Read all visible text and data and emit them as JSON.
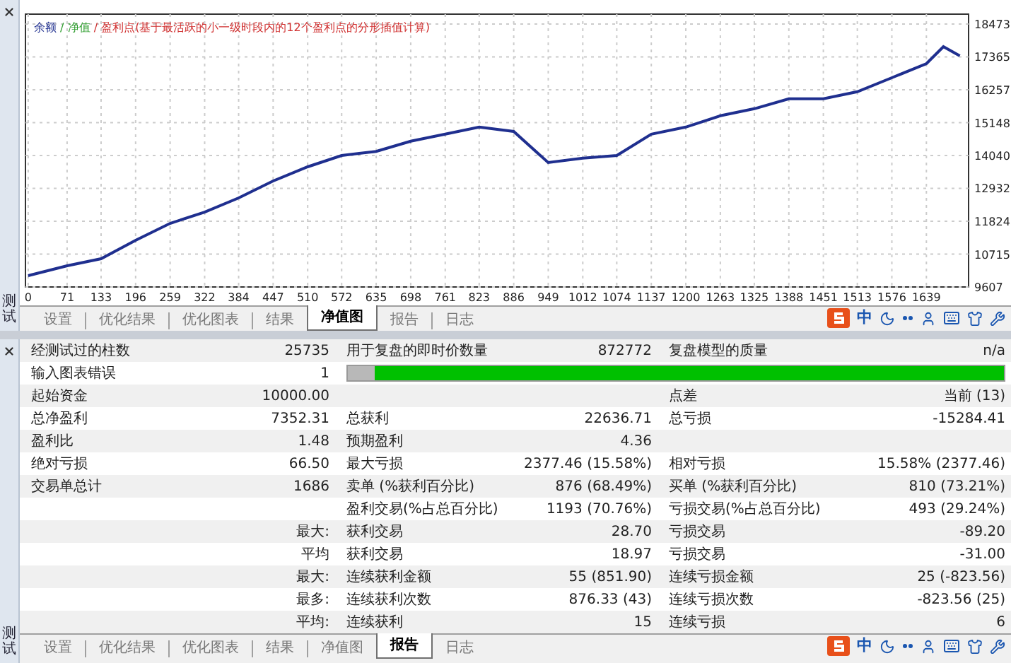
{
  "chart_panel": {
    "side_label": "测试",
    "legend": [
      {
        "text": " / 净值",
        "color": "#2e9e2e"
      },
      {
        "text": " / 盈利点(基于最活跃的小一级时段内的12个盈利点的分形插值计算)",
        "color": "#d03030"
      }
    ],
    "chart_data": {
      "type": "line",
      "grid": true,
      "xlim": [
        -5,
        1716
      ],
      "ylim": [
        9607,
        18473
      ],
      "xticks": [
        0,
        71,
        133,
        196,
        259,
        322,
        384,
        447,
        510,
        572,
        635,
        698,
        761,
        823,
        886,
        949,
        1012,
        1074,
        1137,
        1200,
        1263,
        1325,
        1388,
        1451,
        1513,
        1576,
        1639
      ],
      "yticks": [
        9607,
        10715,
        11824,
        12932,
        14040,
        15148,
        16257,
        17365,
        18473
      ],
      "x": [
        0,
        71,
        133,
        196,
        259,
        322,
        384,
        447,
        510,
        572,
        635,
        698,
        761,
        823,
        886,
        949,
        1012,
        1074,
        1137,
        1200,
        1263,
        1325,
        1388,
        1451,
        1513,
        1576,
        1639,
        1670,
        1700
      ],
      "series": [
        {
          "name": "余额",
          "color": "#1f2f8f",
          "values": [
            9990,
            10320,
            10560,
            11180,
            11750,
            12130,
            12610,
            13180,
            13660,
            14040,
            14180,
            14520,
            14760,
            15000,
            14850,
            13800,
            13950,
            14040,
            14760,
            15000,
            15380,
            15620,
            15950,
            15950,
            16190,
            16660,
            17140,
            17710,
            17400
          ]
        }
      ]
    },
    "tabs": [
      {
        "label": "设置",
        "selected": false
      },
      {
        "label": "优化结果",
        "selected": false
      },
      {
        "label": "优化图表",
        "selected": false
      },
      {
        "label": "结果",
        "selected": false
      },
      {
        "label": "净值图",
        "selected": true
      },
      {
        "label": "报告",
        "selected": false
      },
      {
        "label": "日志",
        "selected": false
      }
    ],
    "tray": {
      "ime": "中"
    }
  },
  "report_panel": {
    "side_label": "测试",
    "rows": [
      {
        "kind": "cells",
        "cells": [
          "经测试过的柱数",
          "25735",
          "用于复盘的即时价数量",
          "872772",
          "复盘模型的质量",
          "n/a"
        ]
      },
      {
        "kind": "bar",
        "cells": [
          "输入图表错误",
          "1"
        ],
        "level": 0.96
      },
      {
        "kind": "cells",
        "cells": [
          "起始资金",
          "10000.00",
          null,
          null,
          "点差",
          "当前 (13)"
        ]
      },
      {
        "kind": "cells",
        "cells": [
          "总净盈利",
          "7352.31",
          "总获利",
          "22636.71",
          "总亏损",
          "-15284.41"
        ]
      },
      {
        "kind": "cells",
        "cells": [
          "盈利比",
          "1.48",
          "预期盈利",
          "4.36",
          null,
          null
        ]
      },
      {
        "kind": "cells",
        "cells": [
          "绝对亏损",
          "66.50",
          "最大亏损",
          "2377.46 (15.58%)",
          "相对亏损",
          "15.58% (2377.46)"
        ]
      },
      {
        "kind": "cells",
        "cells": [
          "交易单总计",
          "1686",
          "卖单 (%获利百分比)",
          "876 (68.49%)",
          "买单 (%获利百分比)",
          "810 (73.21%)"
        ]
      },
      {
        "kind": "cells",
        "cells": [
          null,
          null,
          "盈利交易(%占总百分比)",
          "1193 (70.76%)",
          "亏损交易(%占总百分比)",
          "493 (29.24%)"
        ]
      },
      {
        "kind": "cells",
        "cells": [
          null,
          "最大:",
          "获利交易",
          "28.70",
          "亏损交易",
          "-89.20"
        ]
      },
      {
        "kind": "cells",
        "cells": [
          null,
          "平均",
          "获利交易",
          "18.97",
          "亏损交易",
          "-31.00"
        ]
      },
      {
        "kind": "cells",
        "cells": [
          null,
          "最大:",
          "连续获利金额",
          "55 (851.90)",
          "连续亏损金额",
          "25 (-823.56)"
        ]
      },
      {
        "kind": "cells",
        "cells": [
          null,
          "最多:",
          "连续获利次数",
          "876.33 (43)",
          "连续亏损次数",
          "-823.56 (25)"
        ]
      },
      {
        "kind": "cells",
        "cells": [
          null,
          "平均:",
          "连续获利",
          "15",
          "连续亏损",
          "6"
        ]
      }
    ],
    "tabs": [
      {
        "label": "设置",
        "selected": false
      },
      {
        "label": "优化结果",
        "selected": false
      },
      {
        "label": "优化图表",
        "selected": false
      },
      {
        "label": "结果",
        "selected": false
      },
      {
        "label": "净值图",
        "selected": false
      },
      {
        "label": "报告",
        "selected": true
      },
      {
        "label": "日志",
        "selected": false
      }
    ],
    "tray": {
      "ime": "中"
    }
  }
}
